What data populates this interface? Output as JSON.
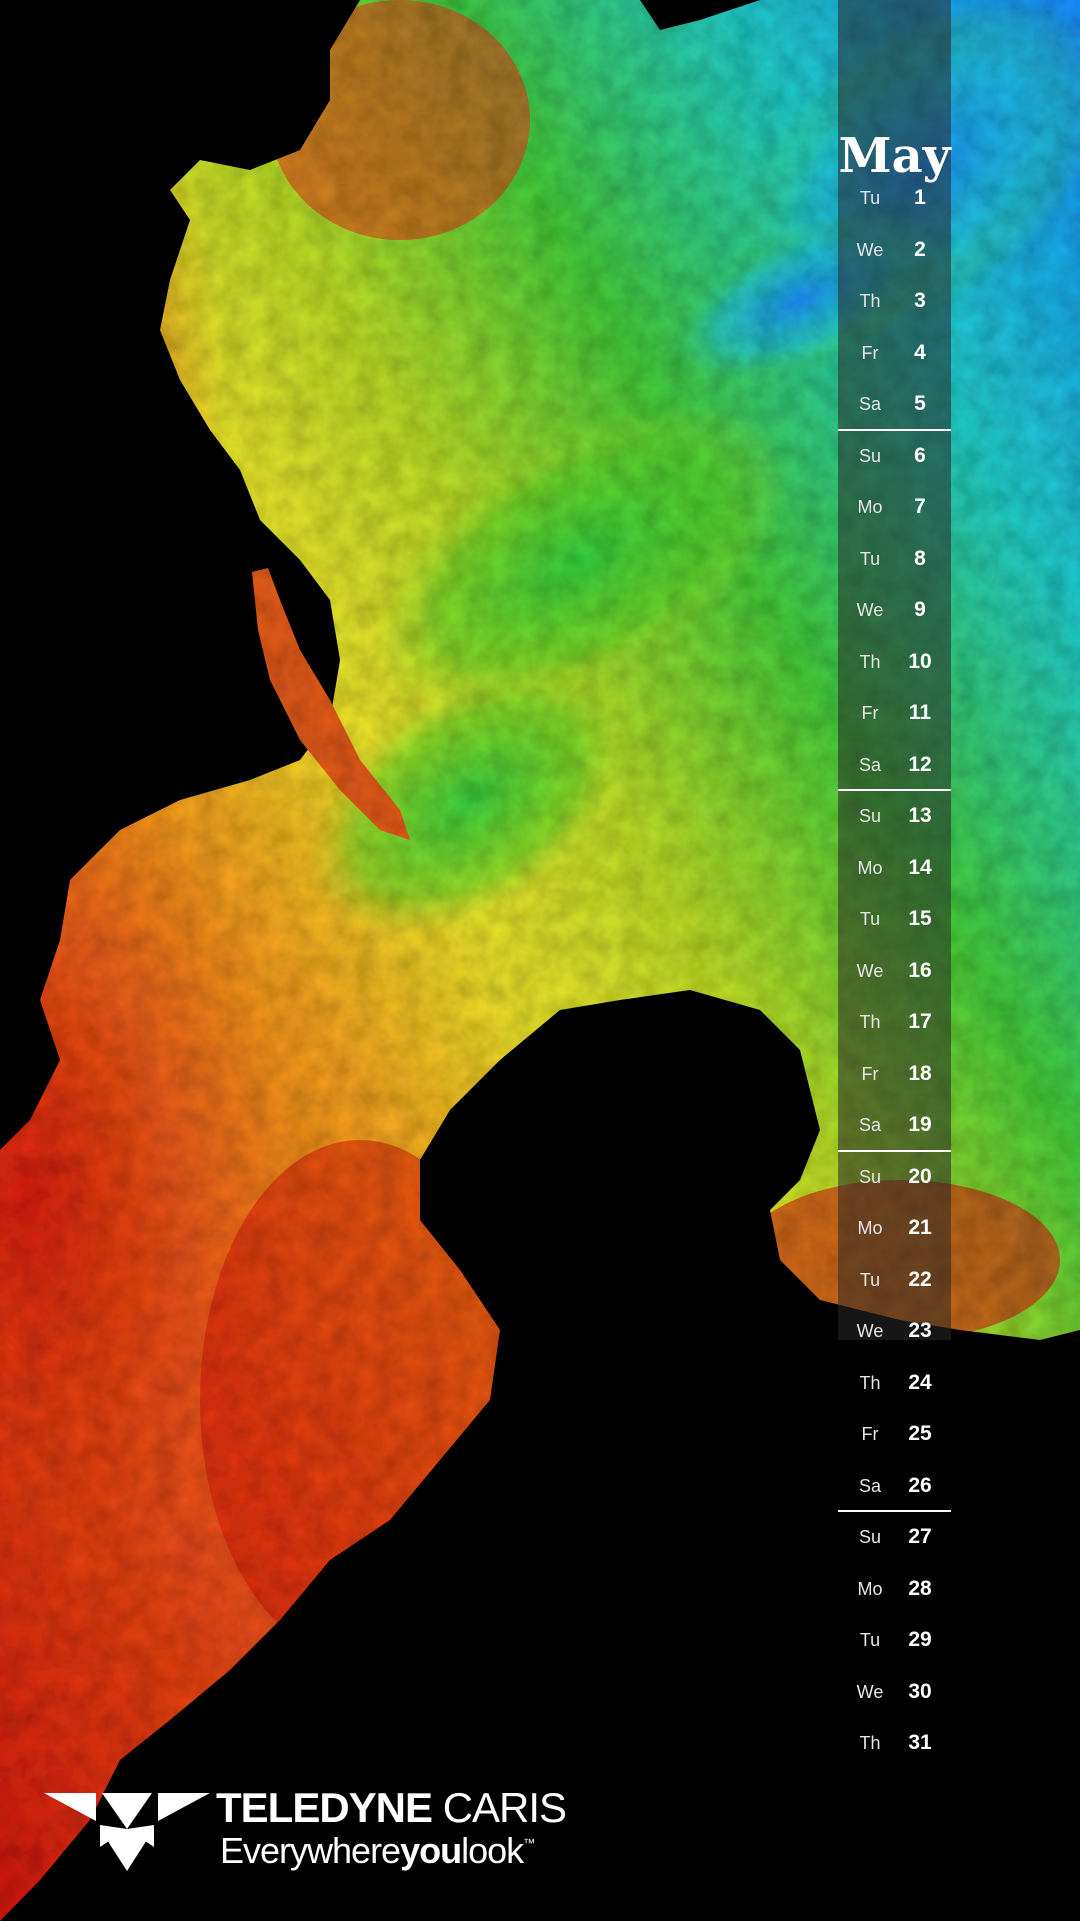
{
  "calendar": {
    "month": "May",
    "days": [
      {
        "dow": "Tu",
        "num": "1"
      },
      {
        "dow": "We",
        "num": "2"
      },
      {
        "dow": "Th",
        "num": "3"
      },
      {
        "dow": "Fr",
        "num": "4"
      },
      {
        "dow": "Sa",
        "num": "5"
      },
      {
        "dow": "Su",
        "num": "6"
      },
      {
        "dow": "Mo",
        "num": "7"
      },
      {
        "dow": "Tu",
        "num": "8"
      },
      {
        "dow": "We",
        "num": "9"
      },
      {
        "dow": "Th",
        "num": "10"
      },
      {
        "dow": "Fr",
        "num": "11"
      },
      {
        "dow": "Sa",
        "num": "12"
      },
      {
        "dow": "Su",
        "num": "13"
      },
      {
        "dow": "Mo",
        "num": "14"
      },
      {
        "dow": "Tu",
        "num": "15"
      },
      {
        "dow": "We",
        "num": "16"
      },
      {
        "dow": "Th",
        "num": "17"
      },
      {
        "dow": "Fr",
        "num": "18"
      },
      {
        "dow": "Sa",
        "num": "19"
      },
      {
        "dow": "Su",
        "num": "20"
      },
      {
        "dow": "Mo",
        "num": "21"
      },
      {
        "dow": "Tu",
        "num": "22"
      },
      {
        "dow": "We",
        "num": "23"
      },
      {
        "dow": "Th",
        "num": "24"
      },
      {
        "dow": "Fr",
        "num": "25"
      },
      {
        "dow": "Sa",
        "num": "26"
      },
      {
        "dow": "Su",
        "num": "27"
      },
      {
        "dow": "Mo",
        "num": "28"
      },
      {
        "dow": "Tu",
        "num": "29"
      },
      {
        "dow": "We",
        "num": "30"
      },
      {
        "dow": "Th",
        "num": "31"
      }
    ]
  },
  "brand": {
    "name_bold": "TELEDYNE",
    "name_light": " CARIS",
    "tagline_a": "Everywhere",
    "tagline_b": "you",
    "tagline_c": "look",
    "trademark": "™"
  },
  "colors": {
    "background": "#000000",
    "deep": "#1e90ff",
    "mid": "#3ac83a",
    "shallow_a": "#e8e82a",
    "shallow_b": "#f08a1e",
    "shallowest": "#d8201a"
  }
}
